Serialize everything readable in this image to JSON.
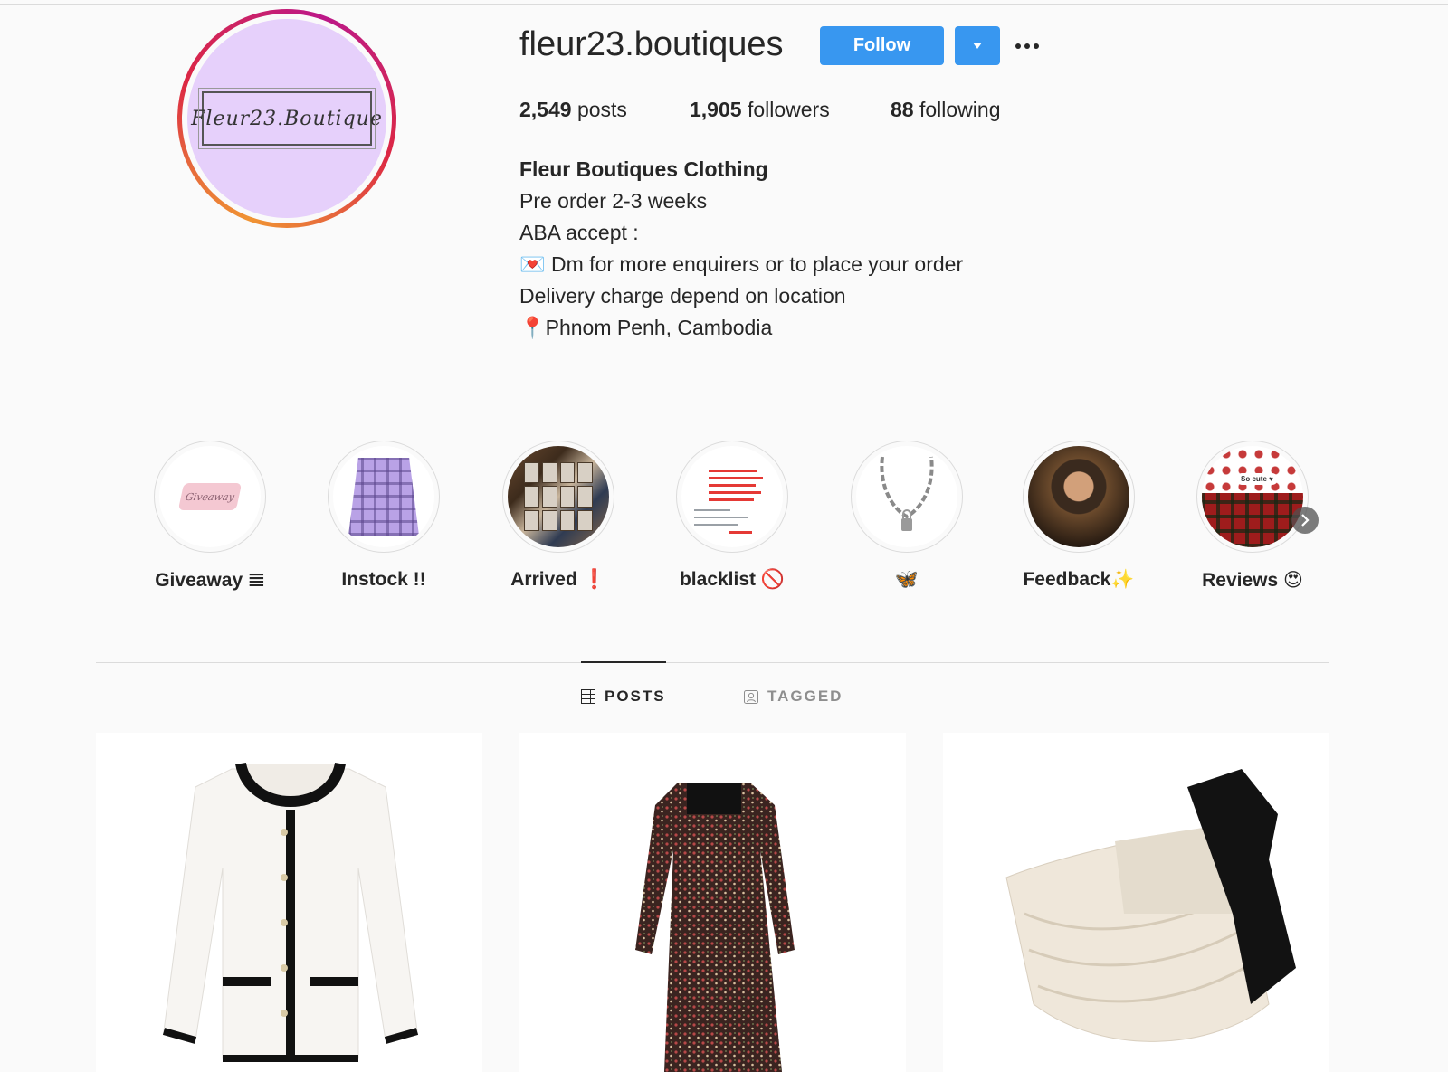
{
  "profile": {
    "username": "fleur23.boutiques",
    "avatar_text": "Fleur23.Boutique",
    "follow_label": "Follow",
    "stats": {
      "posts_count": "2,549",
      "posts_label": "posts",
      "followers_count": "1,905",
      "followers_label": "followers",
      "following_count": "88",
      "following_label": "following"
    },
    "bio": {
      "name": "Fleur Boutiques Clothing",
      "line1": "Pre order 2-3 weeks",
      "line2": "ABA accept :",
      "line3": "💌 Dm for more enquirers or to place your order",
      "line4": "Delivery charge depend on location",
      "line5": "📍Phnom Penh, Cambodia"
    }
  },
  "highlights": [
    {
      "label": "Giveaway 𝌆",
      "thumb_text": "Giveaway"
    },
    {
      "label": "Instock !!"
    },
    {
      "label": "Arrived ❗"
    },
    {
      "label": "blacklist 🚫"
    },
    {
      "label": "🦋"
    },
    {
      "label": "Feedback✨"
    },
    {
      "label": "Reviews 😍",
      "thumb_text": "So cute ♥"
    }
  ],
  "tabs": [
    {
      "label": "POSTS",
      "active": true
    },
    {
      "label": "TAGGED",
      "active": false
    }
  ],
  "colors": {
    "accent": "#3897f0",
    "text": "#262626",
    "muted": "#8e8e8e",
    "background": "#fafafa"
  }
}
